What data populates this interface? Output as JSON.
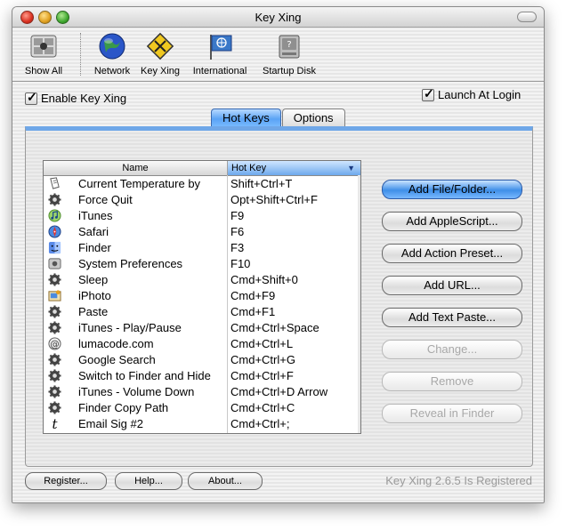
{
  "window": {
    "title": "Key Xing"
  },
  "toolbar": {
    "items": [
      {
        "label": "Show All",
        "icon": "apple-prefs-icon"
      },
      {
        "label": "Network",
        "icon": "globe-icon"
      },
      {
        "label": "Key Xing",
        "icon": "keyxing-icon"
      },
      {
        "label": "International",
        "icon": "flag-icon"
      },
      {
        "label": "Startup Disk",
        "icon": "disk-icon"
      }
    ]
  },
  "options": {
    "enable_label": "Enable Key Xing",
    "launch_label": "Launch At Login",
    "enable_checked": true,
    "launch_checked": true
  },
  "tabs": [
    {
      "label": "Hot Keys",
      "active": true
    },
    {
      "label": "Options",
      "active": false
    }
  ],
  "table": {
    "columns": {
      "name": "Name",
      "hotkey": "Hot Key",
      "sort_arrow": "▼"
    },
    "rows": [
      {
        "name": "Current Temperature by",
        "hotkey": "Shift+Ctrl+T",
        "icon": "script-icon"
      },
      {
        "name": "Force Quit",
        "hotkey": "Opt+Shift+Ctrl+F",
        "icon": "gear-icon"
      },
      {
        "name": "iTunes",
        "hotkey": "F9",
        "icon": "itunes-icon"
      },
      {
        "name": "Safari",
        "hotkey": "F6",
        "icon": "safari-icon"
      },
      {
        "name": "Finder",
        "hotkey": "F3",
        "icon": "finder-icon"
      },
      {
        "name": "System Preferences",
        "hotkey": "F10",
        "icon": "sysprefs-icon"
      },
      {
        "name": "Sleep",
        "hotkey": "Cmd+Shift+0",
        "icon": "gear-icon"
      },
      {
        "name": "iPhoto",
        "hotkey": "Cmd+F9",
        "icon": "iphoto-icon"
      },
      {
        "name": "Paste",
        "hotkey": "Cmd+F1",
        "icon": "gear-icon"
      },
      {
        "name": "iTunes - Play/Pause",
        "hotkey": "Cmd+Ctrl+Space",
        "icon": "gear-icon"
      },
      {
        "name": "lumacode.com",
        "hotkey": "Cmd+Ctrl+L",
        "icon": "at-icon"
      },
      {
        "name": "Google Search",
        "hotkey": "Cmd+Ctrl+G",
        "icon": "gear-icon"
      },
      {
        "name": "Switch to Finder and Hide",
        "hotkey": "Cmd+Ctrl+F",
        "icon": "gear-icon"
      },
      {
        "name": "iTunes - Volume Down",
        "hotkey": "Cmd+Ctrl+D Arrow",
        "icon": "gear-icon"
      },
      {
        "name": "Finder Copy Path",
        "hotkey": "Cmd+Ctrl+C",
        "icon": "gear-icon"
      },
      {
        "name": "Email Sig #2",
        "hotkey": "Cmd+Ctrl+;",
        "icon": "text-icon"
      }
    ]
  },
  "actions": [
    {
      "label": "Add File/Folder...",
      "state": "default"
    },
    {
      "label": "Add AppleScript...",
      "state": "normal"
    },
    {
      "label": "Add Action Preset...",
      "state": "normal"
    },
    {
      "label": "Add URL...",
      "state": "normal"
    },
    {
      "label": "Add Text Paste...",
      "state": "normal"
    },
    {
      "label": "Change...",
      "state": "disabled"
    },
    {
      "label": "Remove",
      "state": "disabled"
    },
    {
      "label": "Reveal in Finder",
      "state": "disabled"
    }
  ],
  "footer": {
    "register_label": "Register...",
    "help_label": "Help...",
    "about_label": "About...",
    "status": "Key Xing 2.6.5 Is Registered"
  },
  "colors": {
    "accent": "#5aa3f5",
    "disabled_text": "#a8a8a8"
  }
}
